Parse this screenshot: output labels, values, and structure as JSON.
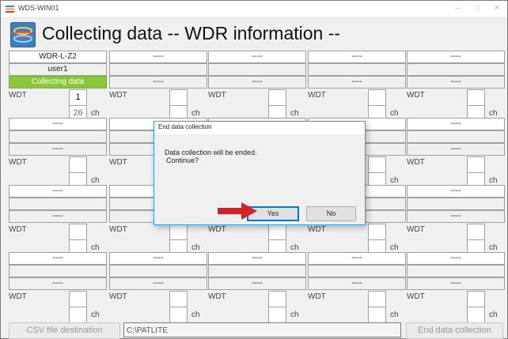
{
  "window": {
    "title": "WDS-WIN01",
    "minimize_glyph": "–",
    "maximize_glyph": "□",
    "close_glyph": "✕"
  },
  "page_title": "Collecting data -- WDR information --",
  "icon_names": {
    "app": "app-icon",
    "header": "wdr-network-icon",
    "arrow": "red-arrow-icon"
  },
  "wdr_grid": [
    [
      {
        "device": "WDR-L-Z2",
        "user": "user1",
        "status": "Collecting data",
        "status_active": true,
        "wdt_label": "WDT",
        "wdt_value": "1",
        "channel": "26",
        "ch_label": "ch"
      },
      {
        "device": "----",
        "user": "",
        "status": "----",
        "status_active": false,
        "wdt_label": "WDT",
        "wdt_value": "",
        "channel": "",
        "ch_label": "ch"
      },
      {
        "device": "----",
        "user": "",
        "status": "----",
        "status_active": false,
        "wdt_label": "WDT",
        "wdt_value": "",
        "channel": "",
        "ch_label": "ch"
      },
      {
        "device": "----",
        "user": "",
        "status": "----",
        "status_active": false,
        "wdt_label": "WDT",
        "wdt_value": "",
        "channel": "",
        "ch_label": "ch"
      },
      {
        "device": "----",
        "user": "",
        "status": "----",
        "status_active": false,
        "wdt_label": "WDT",
        "wdt_value": "",
        "channel": "",
        "ch_label": "ch"
      }
    ],
    [
      {
        "device": "----",
        "user": "",
        "status": "----",
        "status_active": false,
        "wdt_label": "WDT",
        "wdt_value": "",
        "channel": "",
        "ch_label": "ch"
      },
      {
        "device": "----",
        "user": "",
        "status": "----",
        "status_active": false,
        "wdt_label": "WDT",
        "wdt_value": "",
        "channel": "",
        "ch_label": "ch"
      },
      {
        "device": "----",
        "user": "",
        "status": "----",
        "status_active": false,
        "wdt_label": "WDT",
        "wdt_value": "",
        "channel": "",
        "ch_label": "ch"
      },
      {
        "device": "----",
        "user": "",
        "status": "----",
        "status_active": false,
        "wdt_label": "WDT",
        "wdt_value": "",
        "channel": "",
        "ch_label": "ch"
      },
      {
        "device": "----",
        "user": "",
        "status": "----",
        "status_active": false,
        "wdt_label": "WDT",
        "wdt_value": "",
        "channel": "",
        "ch_label": "ch"
      }
    ],
    [
      {
        "device": "----",
        "user": "",
        "status": "----",
        "status_active": false,
        "wdt_label": "WDT",
        "wdt_value": "",
        "channel": "",
        "ch_label": "ch"
      },
      {
        "device": "----",
        "user": "",
        "status": "----",
        "status_active": false,
        "wdt_label": "WDT",
        "wdt_value": "",
        "channel": "",
        "ch_label": "ch"
      },
      {
        "device": "----",
        "user": "",
        "status": "----",
        "status_active": false,
        "wdt_label": "WDT",
        "wdt_value": "",
        "channel": "",
        "ch_label": "ch"
      },
      {
        "device": "----",
        "user": "",
        "status": "----",
        "status_active": false,
        "wdt_label": "WDT",
        "wdt_value": "",
        "channel": "",
        "ch_label": "ch"
      },
      {
        "device": "----",
        "user": "",
        "status": "----",
        "status_active": false,
        "wdt_label": "WDT",
        "wdt_value": "",
        "channel": "",
        "ch_label": "ch"
      }
    ],
    [
      {
        "device": "----",
        "user": "",
        "status": "----",
        "status_active": false,
        "wdt_label": "WDT",
        "wdt_value": "",
        "channel": "",
        "ch_label": "ch"
      },
      {
        "device": "----",
        "user": "",
        "status": "----",
        "status_active": false,
        "wdt_label": "WDT",
        "wdt_value": "",
        "channel": "",
        "ch_label": "ch"
      },
      {
        "device": "----",
        "user": "",
        "status": "----",
        "status_active": false,
        "wdt_label": "WDT",
        "wdt_value": "",
        "channel": "",
        "ch_label": "ch"
      },
      {
        "device": "----",
        "user": "",
        "status": "----",
        "status_active": false,
        "wdt_label": "WDT",
        "wdt_value": "",
        "channel": "",
        "ch_label": "ch"
      },
      {
        "device": "----",
        "user": "",
        "status": "----",
        "status_active": false,
        "wdt_label": "WDT",
        "wdt_value": "",
        "channel": "",
        "ch_label": "ch"
      }
    ]
  ],
  "dialog": {
    "title": "End data collection",
    "message_line1": "Data collection will be ended.",
    "message_line2": "Continue?",
    "yes_label": "Yes",
    "no_label": "No"
  },
  "footer": {
    "csv_button_label": "CSV file destination",
    "path_value": "C:\\PATLITE",
    "end_button_label": "End data collection"
  },
  "colors": {
    "status_green": "#8cc63f",
    "arrow_red": "#d42027",
    "dialog_border": "#3c9bd9"
  }
}
